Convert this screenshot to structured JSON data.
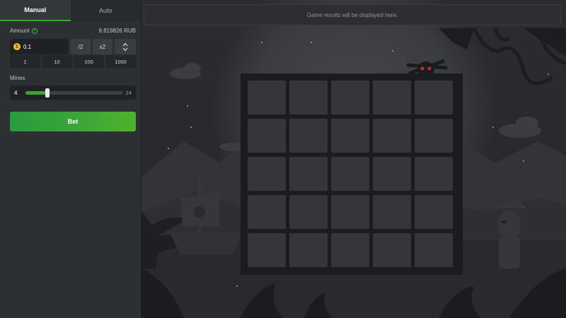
{
  "tabs": [
    {
      "label": "Manual",
      "active": true
    },
    {
      "label": "Auto",
      "active": false
    }
  ],
  "amount": {
    "label": "Amount",
    "balance": "9.819826 RUB",
    "value": "0.1",
    "half_label": "/2",
    "double_label": "x2",
    "quick_values": [
      "1",
      "10",
      "100",
      "1000"
    ]
  },
  "mines": {
    "label": "Mines",
    "value": "4",
    "max_label": "24",
    "min": 1,
    "max": 24,
    "current": 4
  },
  "bet_button": {
    "label": "Bet"
  },
  "game": {
    "results_placeholder": "Game results will be displayed here.",
    "grid_rows": 5,
    "grid_cols": 5
  },
  "colors": {
    "accent_green": "#3ba235",
    "tile": "#34363b",
    "board": "#1b1c1f"
  },
  "icons": [
    "info-icon",
    "coin-icon",
    "chevron-up-icon",
    "chevron-down-icon",
    "skull-icon"
  ]
}
